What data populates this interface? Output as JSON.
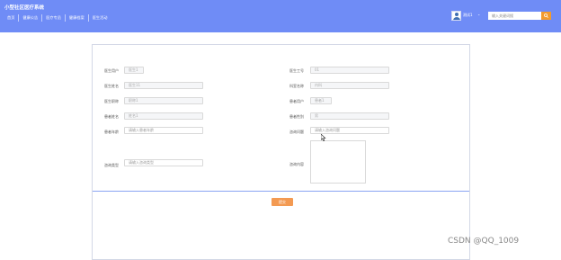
{
  "header": {
    "title": "小型社区医疗系统",
    "nav": [
      "首页",
      "健康公告",
      "医疗专员",
      "健康档案",
      "医生活动"
    ],
    "username": "测试1",
    "user_caret": "⌄",
    "search_placeholder": "输入关键词搜",
    "background_color": "#6f8cf6",
    "search_button_color": "#f39a2d"
  },
  "form": {
    "fields": [
      {
        "label": "医生用户",
        "value": "医生1"
      },
      {
        "label": "医生工号",
        "value": "01"
      },
      {
        "label": "医生姓名",
        "value": "医生11"
      },
      {
        "label": "科室名称",
        "value": "内科"
      },
      {
        "label": "医生职称",
        "value": "职称1"
      },
      {
        "label": "患者用户",
        "value": "患者1"
      },
      {
        "label": "患者姓名",
        "value": "姓名1"
      },
      {
        "label": "患者性别",
        "value": "男"
      },
      {
        "label": "患者年龄",
        "placeholder": "请输入患者年龄"
      },
      {
        "label": "咨询问题",
        "placeholder": "请输入咨询问题"
      },
      {
        "label": "咨询类型",
        "placeholder": "请输入咨询类型"
      },
      {
        "label": "咨询内容",
        "value": ""
      }
    ],
    "submit_label": "提交",
    "submit_color": "#f39a52"
  },
  "watermark": "CSDN @QQ_1009"
}
